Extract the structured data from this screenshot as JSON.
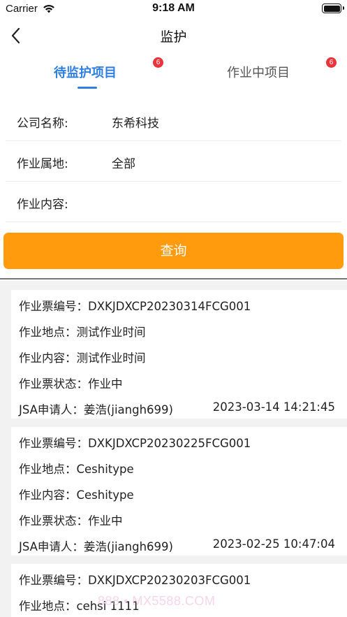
{
  "status_bar": {
    "carrier": "Carrier",
    "time": "9:18 AM",
    "wifi_icon": "wifi-icon",
    "battery_icon": "battery-icon"
  },
  "nav": {
    "title": "监护",
    "back_icon": "chevron-left-icon"
  },
  "tabs": [
    {
      "label": "待监护项目",
      "badge": "6",
      "active": true
    },
    {
      "label": "作业中项目",
      "badge": "6",
      "active": false
    }
  ],
  "colors": {
    "accent": "#2f7fe0",
    "button": "#ff9b0d",
    "badge": "#e8343a"
  },
  "filters": {
    "company": {
      "label": "公司名称:",
      "value": "东希科技"
    },
    "location": {
      "label": "作业属地:",
      "value": "全部"
    },
    "content": {
      "label": "作业内容:",
      "value": ""
    },
    "query_label": "查询"
  },
  "records": [
    {
      "ticket_no": "作业票编号：DXKJDXCP20230314FCG001",
      "place": "作业地点：测试作业时间",
      "content": "作业内容：测试作业时间",
      "status": "作业票状态：作业中",
      "applicant": "JSA申请人：姜浩(jiangh699)",
      "time": "2023-03-14 14:21:45"
    },
    {
      "ticket_no": "作业票编号：DXKJDXCP20230225FCG001",
      "place": "作业地点：Ceshitype",
      "content": "作业内容：Ceshitype",
      "status": "作业票状态：作业中",
      "applicant": "JSA申请人：姜浩(jiangh699)",
      "time": "2023-02-25 10:47:04"
    },
    {
      "ticket_no": "作业票编号：DXKJDXCP20230203FCG001",
      "place": "作业地点：cehsi 1111"
    }
  ],
  "watermark": "888 • MX5588.COM"
}
